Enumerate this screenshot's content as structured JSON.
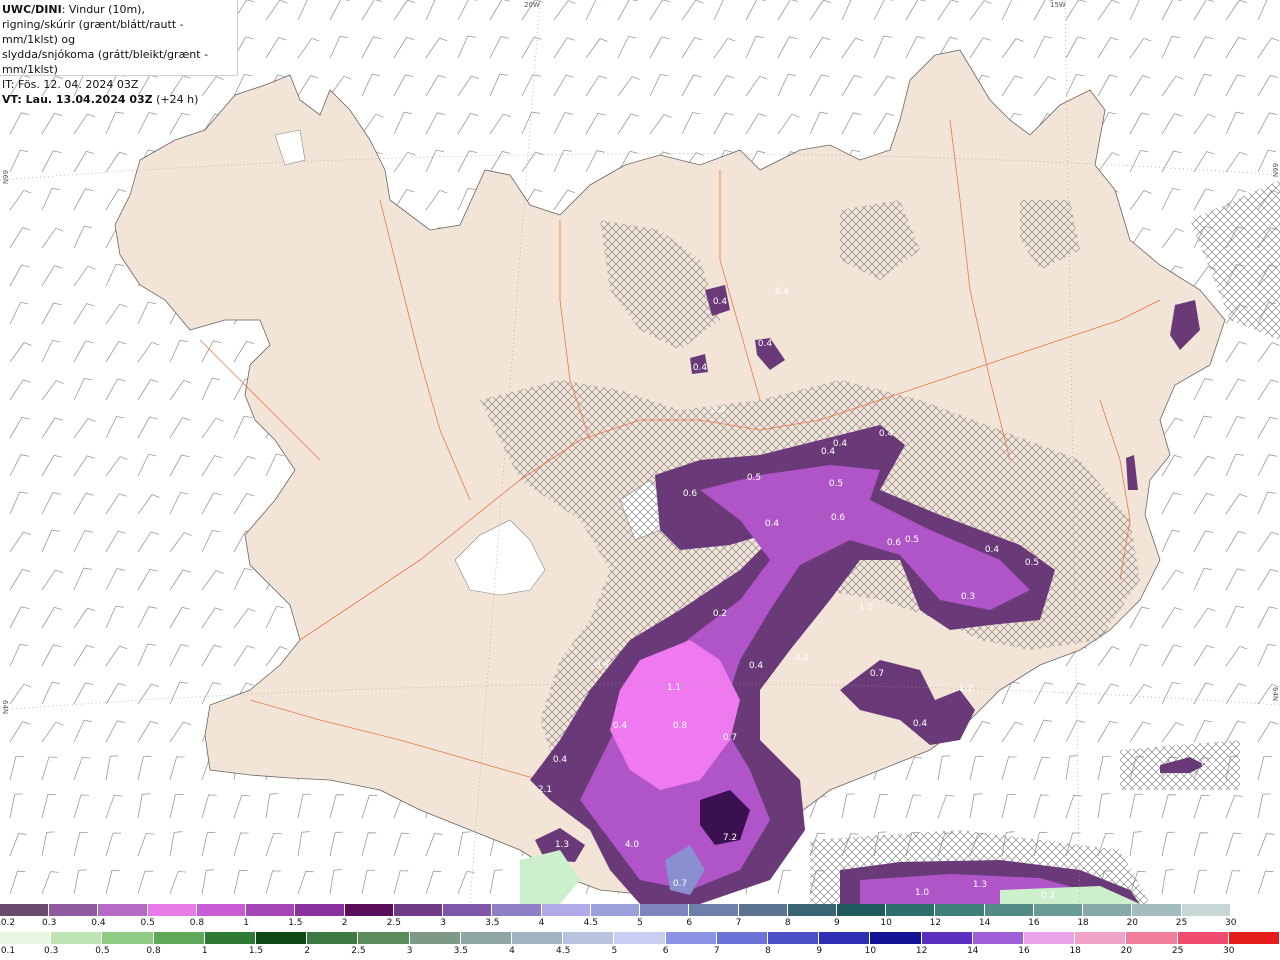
{
  "title": {
    "line1_bold": "UWC/DINI",
    "line1_rest": ": Vindur (10m),",
    "line2": "rigning/skúrir (grænt/blátt/rautt - mm/1klst) og",
    "line3": "slydda/snjókoma (grátt/bleikt/grænt - mm/1klst)",
    "it": "IT: Fös. 12. 04. 2024 03Z",
    "vt_bold": "VT: Lau. 13.04.2024 03Z",
    "vt_rest": " (+24 h)"
  },
  "grid_labels": [
    "20W",
    "15W",
    "66N",
    "66N",
    "64N",
    "64N"
  ],
  "colors": {
    "land": "#f2e4d6",
    "sea": "#ffffff",
    "roads": "#e8784a",
    "precip_dark": "#6a3a78",
    "precip_mid": "#b055c8",
    "precip_light": "#ef7af0",
    "precip_deep": "#3b1050"
  },
  "map_values": [
    "0.4",
    "0.4",
    "0.4",
    "0.4",
    "0.4",
    "0.4",
    "0.4",
    "0.4",
    "0.5",
    "0.5",
    "0.6",
    "0.4",
    "0.6",
    "0.6",
    "0.5",
    "0.4",
    "0.5",
    "0.3",
    "0.2",
    "1.0",
    "0.4",
    "0.2",
    "0.9",
    "1.1",
    "0.8",
    "0.7",
    "0.4",
    "0.4",
    "2.1",
    "1.3",
    "4.0",
    "7.2",
    "0.7",
    "1.0",
    "1.3",
    "0.2",
    "0.4",
    "0.7",
    "1.2",
    "0.4",
    "0.5"
  ],
  "legend_top": {
    "labels": [
      "0.2",
      "0.3",
      "0.4",
      "0.5",
      "0.8",
      "1",
      "1.5",
      "2",
      "2.5",
      "3",
      "3.5",
      "4",
      "4.5",
      "5",
      "6",
      "7",
      "8",
      "9",
      "10",
      "12",
      "14",
      "16",
      "18",
      "20",
      "25",
      "30"
    ],
    "colors": [
      "#6b4a6f",
      "#8f5aa0",
      "#b56ac5",
      "#e77be8",
      "#c95bd6",
      "#a445b8",
      "#8a2f9e",
      "#5a0d5a",
      "#713b85",
      "#7e57a8",
      "#8f7fc7",
      "#b0aae8",
      "#9aa0d9",
      "#7f84bd",
      "#6d7fab",
      "#5b7290",
      "#3a6474",
      "#1e5a5e",
      "#2f6e6e",
      "#3e7f7a",
      "#548a86",
      "#6a9a96",
      "#86a9a6",
      "#a2bdbb",
      "#c7d7d6",
      "#ffffff"
    ]
  },
  "legend_bottom": {
    "labels": [
      "0.1",
      "0.3",
      "0.5",
      "0.8",
      "1",
      "1.5",
      "2",
      "2.5",
      "3",
      "3.5",
      "4",
      "4.5",
      "5",
      "6",
      "7",
      "8",
      "9",
      "10",
      "12",
      "14",
      "16",
      "18",
      "20",
      "25",
      "30"
    ],
    "colors": [
      "#e6f6e0",
      "#bfe4b4",
      "#8ecb83",
      "#5fa85a",
      "#2d7a34",
      "#0d4a17",
      "#3d7a43",
      "#5a8c5e",
      "#7c9a85",
      "#8fa7a4",
      "#9fb3c0",
      "#b8c4df",
      "#c9cdf2",
      "#8c93e6",
      "#6b72d9",
      "#4b50c8",
      "#2e2eb6",
      "#121296",
      "#5a2fbf",
      "#9e5fd9",
      "#e8a3e8",
      "#f0a2c8",
      "#f07d9a",
      "#ef4b6c",
      "#e61b1b"
    ]
  }
}
